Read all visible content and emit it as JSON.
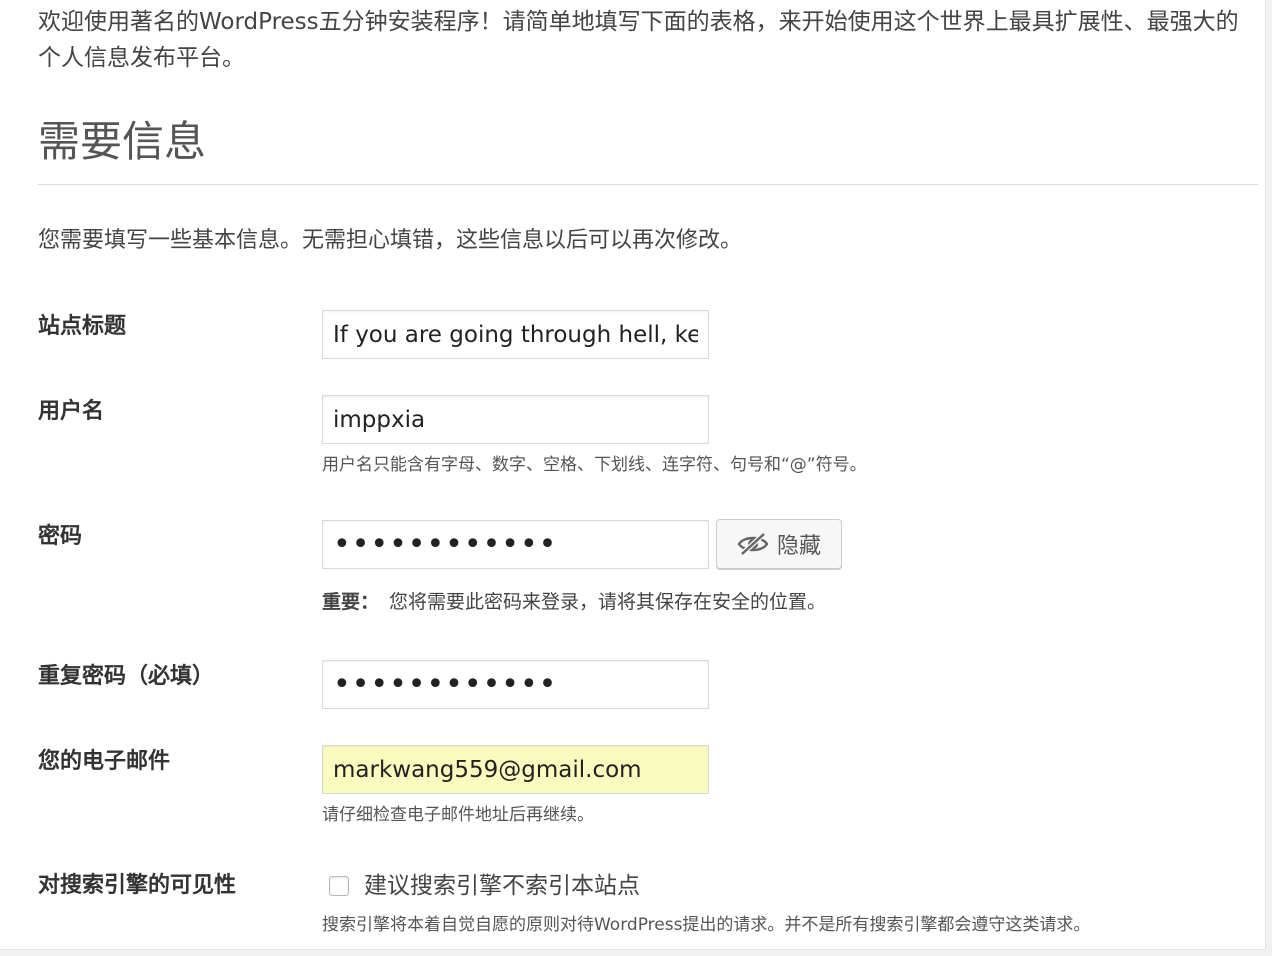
{
  "intro": "欢迎使用著名的WordPress五分钟安装程序！请简单地填写下面的表格，来开始使用这个世界上最具扩展性、最强大的个人信息发布平台。",
  "section": {
    "title": "需要信息",
    "description": "您需要填写一些基本信息。无需担心填错，这些信息以后可以再次修改。"
  },
  "fields": {
    "site_title": {
      "label": "站点标题",
      "value": "If you are going through hell, keep going"
    },
    "username": {
      "label": "用户名",
      "value": "imppxia",
      "hint": "用户名只能含有字母、数字、空格、下划线、连字符、句号和“@”符号。"
    },
    "password": {
      "label": "密码",
      "value": "••••••••••••",
      "toggle_label": "隐藏",
      "toggle_icon": "eye-slash-icon",
      "important_prefix": "重要：",
      "important_text": "您将需要此密码来登录，请将其保存在安全的位置。"
    },
    "password_repeat": {
      "label": "重复密码（必填）",
      "value": "••••••••••••"
    },
    "email": {
      "label": "您的电子邮件",
      "value": "markwang559@gmail.com",
      "hint": "请仔细检查电子邮件地址后再继续。",
      "autofill_color": "#fafbbf"
    },
    "search_visibility": {
      "label": "对搜索引擎的可见性",
      "checkbox_label": "建议搜索引擎不索引本站点",
      "checked": false,
      "hint": "搜索引擎将本着自觉自愿的原则对待WordPress提出的请求。并不是所有搜索引擎都会遵守这类请求。"
    }
  }
}
